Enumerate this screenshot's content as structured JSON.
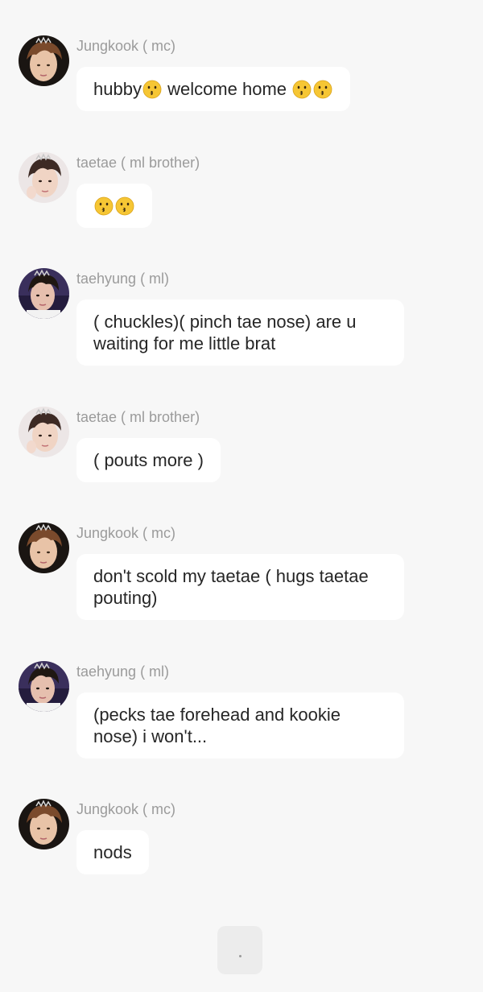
{
  "messages": [
    {
      "sender": "Jungkook ( mc)",
      "avatar": "jungkook-avatar",
      "parts": [
        "hubby",
        "kiss-emoji",
        " welcome home ",
        "kiss-emoji",
        "kiss-emoji"
      ]
    },
    {
      "sender": "taetae ( ml brother)",
      "avatar": "taetae-avatar",
      "parts": [
        "kiss-emoji",
        "kiss-emoji"
      ]
    },
    {
      "sender": "taehyung ( ml)",
      "avatar": "taehyung-avatar",
      "text": "( chuckles)( pinch tae nose) are u waiting for me little brat"
    },
    {
      "sender": "taetae ( ml brother)",
      "avatar": "taetae-avatar",
      "text": "( pouts more )"
    },
    {
      "sender": "Jungkook ( mc)",
      "avatar": "jungkook-avatar",
      "text": "don't scold my taetae ( hugs taetae pouting)"
    },
    {
      "sender": "taehyung ( ml)",
      "avatar": "taehyung-avatar",
      "text": "(pecks tae forehead and kookie nose) i won't..."
    },
    {
      "sender": "Jungkook ( mc)",
      "avatar": "jungkook-avatar",
      "text": "nods"
    }
  ],
  "typing_indicator": {
    "text": "."
  },
  "colors": {
    "background": "#f7f7f7",
    "bubble": "#ffffff",
    "sender_text": "#9b9b9b",
    "message_text": "#262626"
  }
}
